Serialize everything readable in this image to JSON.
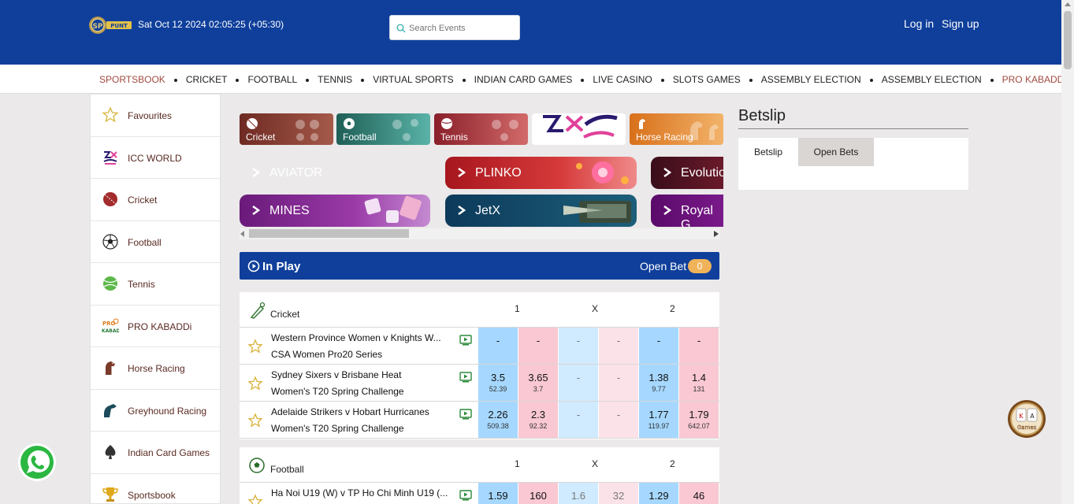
{
  "header": {
    "logo_text": "PUNT",
    "datetime": "Sat Oct 12 2024 02:05:25  (+05:30)",
    "search_placeholder": "Search Events",
    "login": "Log in",
    "signup": "Sign up"
  },
  "nav": {
    "items": [
      {
        "label": "SPORTSBOOK",
        "accent": true
      },
      {
        "label": "CRICKET"
      },
      {
        "label": "FOOTBALL"
      },
      {
        "label": "TENNIS"
      },
      {
        "label": "VIRTUAL SPORTS"
      },
      {
        "label": "INDIAN CARD GAMES"
      },
      {
        "label": "LIVE CASINO"
      },
      {
        "label": "SLOTS GAMES"
      },
      {
        "label": "ASSEMBLY ELECTION"
      },
      {
        "label": "ASSEMBLY ELECTION"
      },
      {
        "label": "PRO KABADDI",
        "accent": true
      }
    ]
  },
  "sidebar": {
    "items": [
      {
        "label": "Favourites",
        "icon": "star-icon"
      },
      {
        "label": "ICC WORLD",
        "icon": "icc-world-icon"
      },
      {
        "label": "Cricket",
        "icon": "cricket-ball-icon"
      },
      {
        "label": "Football",
        "icon": "football-icon"
      },
      {
        "label": "Tennis",
        "icon": "tennis-ball-icon"
      },
      {
        "label": "PRO KABADDi",
        "icon": "pro-kabaddi-icon"
      },
      {
        "label": "Horse Racing",
        "icon": "horse-icon"
      },
      {
        "label": "Greyhound Racing",
        "icon": "greyhound-icon"
      },
      {
        "label": "Indian Card Games",
        "icon": "spade-icon"
      },
      {
        "label": "Sportsbook",
        "icon": "trophy-icon"
      }
    ]
  },
  "sport_tiles": {
    "cricket": "Cricket",
    "football": "Football",
    "tennis": "Tennis",
    "horse_racing": "Horse Racing"
  },
  "games": {
    "aviator": "AVIATOR",
    "plinko": "PLINKO",
    "evolution": "Evolutio",
    "mines": "MINES",
    "jetx": "JetX",
    "royal": "Royal G"
  },
  "inplay": {
    "title": "In Play",
    "open_bet": "Open Bet",
    "open_bet_count": "0"
  },
  "columns": {
    "c1": "1",
    "cx": "X",
    "c2": "2"
  },
  "cricket": {
    "title": "Cricket",
    "rows": [
      {
        "team": "Western Province Women v Knights W...",
        "league": "CSA Women Pro20 Series",
        "odds": [
          {
            "p": "-",
            "v": ""
          },
          {
            "p": "-",
            "v": ""
          },
          {
            "p": "-",
            "v": ""
          },
          {
            "p": "-",
            "v": ""
          },
          {
            "p": "-",
            "v": ""
          },
          {
            "p": "-",
            "v": ""
          }
        ]
      },
      {
        "team": "Sydney Sixers v Brisbane Heat",
        "league": "Women's T20 Spring Challenge",
        "odds": [
          {
            "p": "3.5",
            "v": "52.39"
          },
          {
            "p": "3.65",
            "v": "3.7"
          },
          {
            "p": "-",
            "v": ""
          },
          {
            "p": "-",
            "v": ""
          },
          {
            "p": "1.38",
            "v": "9.77"
          },
          {
            "p": "1.4",
            "v": "131"
          }
        ]
      },
      {
        "team": "Adelaide Strikers v Hobart Hurricanes",
        "league": "Women's T20 Spring Challenge",
        "odds": [
          {
            "p": "2.26",
            "v": "509.38"
          },
          {
            "p": "2.3",
            "v": "92.32"
          },
          {
            "p": "-",
            "v": ""
          },
          {
            "p": "-",
            "v": ""
          },
          {
            "p": "1.77",
            "v": "119.97"
          },
          {
            "p": "1.79",
            "v": "642.07"
          }
        ]
      }
    ]
  },
  "football": {
    "title": "Football",
    "rows": [
      {
        "team": "Ha Noi U19 (W) v TP Ho Chi Minh U19 (...",
        "league": "",
        "odds": [
          {
            "p": "1.59",
            "v": ""
          },
          {
            "p": "160",
            "v": ""
          },
          {
            "p": "1.6",
            "v": ""
          },
          {
            "p": "32",
            "v": ""
          },
          {
            "p": "1.29",
            "v": ""
          },
          {
            "p": "46",
            "v": ""
          }
        ]
      }
    ]
  },
  "betslip": {
    "title": "Betslip",
    "tab_betslip": "Betslip",
    "tab_open_bets": "Open Bets"
  },
  "chip_label": "Games"
}
